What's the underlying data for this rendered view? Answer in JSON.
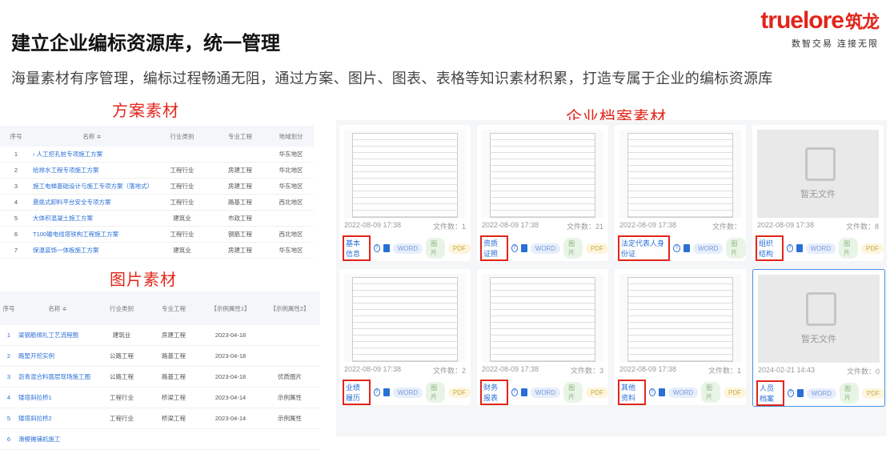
{
  "header": {
    "title": "建立企业编标资源库，统一管理",
    "subtitle": "海量素材有序管理，编标过程畅通无阻，通过方案、图片、图表、表格等知识素材积累，打造专属于企业的编标资源库",
    "logo_brand": "truelore",
    "logo_cn": "筑龙",
    "logo_slogan": "数智交易  连接无限"
  },
  "sections": {
    "plan": "方案素材",
    "image": "图片素材",
    "enterprise": "企业档案素材"
  },
  "plan_table": {
    "headers": [
      "序号",
      "名称 ≑",
      "行业类别",
      "专业工程",
      "地域划分"
    ],
    "rows": [
      {
        "no": "1",
        "name": "› 人工挖孔桩专项施工方案",
        "industry": "",
        "major": "",
        "region": "华东地区"
      },
      {
        "no": "2",
        "name": "给排水工程专项施工方案",
        "industry": "工程行业",
        "major": "房建工程",
        "region": "华北地区"
      },
      {
        "no": "3",
        "name": "施工电梯基础设计与施工专项方案（落地式）",
        "industry": "工程行业",
        "major": "房建工程",
        "region": "华东地区"
      },
      {
        "no": "4",
        "name": "悬挑式卸料平台安全专项方案",
        "industry": "工程行业",
        "major": "路基工程",
        "region": "西北地区"
      },
      {
        "no": "5",
        "name": "大体积混凝土施工方案",
        "industry": "建筑业",
        "major": "市政工程",
        "region": ""
      },
      {
        "no": "6",
        "name": "T100输电线塔铁构工程施工方案",
        "industry": "工程行业",
        "major": "钢筋工程",
        "region": "西北地区"
      },
      {
        "no": "7",
        "name": "保温装饰一体板施工方案",
        "industry": "建筑业",
        "major": "房建工程",
        "region": "华东地区"
      }
    ]
  },
  "image_table": {
    "headers": [
      "序号",
      "名称 ≑",
      "行业类别",
      "专业工程",
      "【示例属性1】",
      "【示例属性2】"
    ],
    "rows": [
      {
        "no": "1",
        "name": "梁钢筋绑扎工艺流程图",
        "industry": "建筑业",
        "major": "房建工程",
        "date": "2023-04-18",
        "attr": ""
      },
      {
        "no": "2",
        "name": "路堑开挖实例",
        "industry": "公路工程",
        "major": "路基工程",
        "date": "2023-04-18",
        "attr": ""
      },
      {
        "no": "3",
        "name": "沥青混合料面层现场施工图",
        "industry": "公路工程",
        "major": "路基工程",
        "date": "2023-04-18",
        "attr": "优质图片"
      },
      {
        "no": "4",
        "name": "矮塔斜拉桥1",
        "industry": "工程行业",
        "major": "桥梁工程",
        "date": "2023-04-14",
        "attr": "示例属性"
      },
      {
        "no": "5",
        "name": "矮塔斜拉桥2",
        "industry": "工程行业",
        "major": "桥梁工程",
        "date": "2023-04-14",
        "attr": "示例属性"
      },
      {
        "no": "6",
        "name": "滑模摊铺机施工",
        "industry": "",
        "major": "",
        "date": "",
        "attr": ""
      }
    ]
  },
  "tag_labels": {
    "word": "WORD",
    "image": "图片",
    "pdf": "PDF"
  },
  "files_label": "文件数：",
  "empty_label": "暂无文件",
  "cards": [
    {
      "category": "基本信息",
      "date": "2022-08-09 17:38",
      "count": "1",
      "type": "doc",
      "pdf": true
    },
    {
      "category": "资质证照",
      "date": "2022-08-09 17:38",
      "count": "21",
      "type": "doc",
      "pdf": true
    },
    {
      "category": "法定代表人身份证",
      "date": "2022-08-09 17:38",
      "count": "",
      "type": "doc",
      "pdf": false
    },
    {
      "category": "组织结构",
      "date": "2022-08-09 17:38",
      "count": "8",
      "type": "empty",
      "pdf": true
    },
    {
      "category": "业绩履历",
      "date": "2022-08-09 17:38",
      "count": "2",
      "type": "doc",
      "pdf": true
    },
    {
      "category": "财务报表",
      "date": "2022-08-09 17:38",
      "count": "3",
      "type": "doc",
      "pdf": true
    },
    {
      "category": "其他资料",
      "date": "2022-08-09 17:38",
      "count": "1",
      "type": "doc",
      "pdf": true
    },
    {
      "category": "人员档案",
      "date": "2024-02-21 14:43",
      "count": "0",
      "type": "empty",
      "pdf": true
    }
  ]
}
